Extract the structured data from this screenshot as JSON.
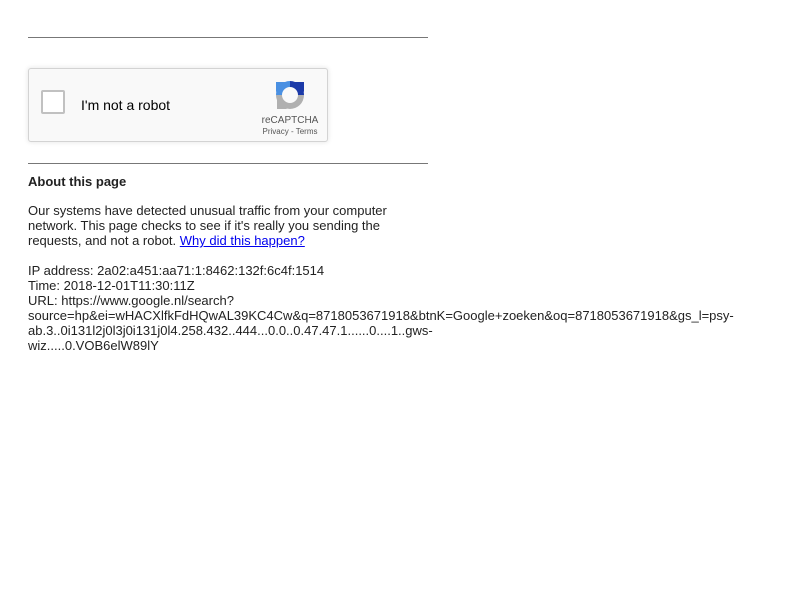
{
  "recaptcha": {
    "checkbox_label": "I'm not a robot",
    "brand": "reCAPTCHA",
    "privacy_link": "Privacy",
    "separator": " - ",
    "terms_link": "Terms",
    "logo_icon": "recaptcha-logo-icon",
    "colors": {
      "blue": "#1c3aa9",
      "light_blue": "#4a90e2",
      "gray": "#b0b0b0"
    }
  },
  "about": {
    "heading": "About this page",
    "paragraph": "Our systems have detected unusual traffic from your computer network. This page checks to see if it's really you sending the requests, and not a robot. ",
    "why_link": "Why did this happen?"
  },
  "info": {
    "ip_line": "IP address: 2a02:a451:aa71:1:8462:132f:6c4f:1514",
    "time_line": "Time: 2018-12-01T11:30:11Z",
    "url_line_1": "URL: https://www.google.nl/search?",
    "url_line_2": "source=hp&ei=wHACXlfkFdHQwAL39KC4Cw&q=8718053671918&btnK=Google+zoeken&oq=8718053671918&gs_l=psy-",
    "url_line_3": "ab.3..0i131l2j0l3j0i131j0l4.258.432..444...0.0..0.47.47.1......0....1..gws-",
    "url_line_4": "wiz.....0.VOB6elW89lY"
  }
}
